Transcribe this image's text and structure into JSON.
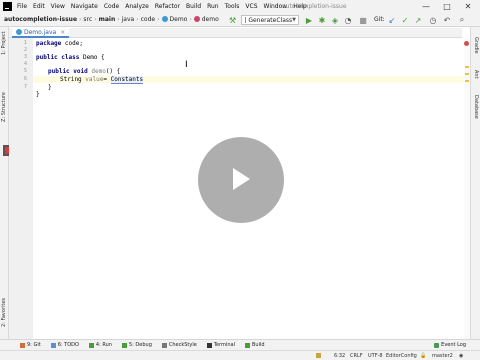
{
  "menubar": {
    "items": [
      "File",
      "Edit",
      "View",
      "Navigate",
      "Code",
      "Analyze",
      "Refactor",
      "Build",
      "Run",
      "Tools",
      "VCS",
      "Window",
      "Help"
    ],
    "window_title": "autocompletion-issue",
    "controls": [
      "—",
      "□",
      "✕"
    ]
  },
  "navbar": {
    "crumbs": [
      "autocompletion-issue",
      "src",
      "main",
      "java",
      "code",
      "Demo",
      "demo"
    ],
    "run_config": "GenerateClass",
    "git_label": "Git:"
  },
  "tabs": [
    {
      "label": "Demo.java",
      "close": "×"
    }
  ],
  "left_strip": {
    "project": "1: Project",
    "structure": "Z: Structure",
    "favorites": "2: Favorites"
  },
  "right_strip": {
    "gradle": "Gradle",
    "ant": "Ant",
    "database": "Database"
  },
  "editor": {
    "line_numbers": [
      "1",
      "2",
      "3",
      "4",
      "5",
      "6",
      "7"
    ],
    "package_kw": "package",
    "package_name": " code;",
    "public_kw": "public",
    "class_kw": " class",
    "class_name": " Demo {",
    "public_kw2": "public",
    "void_kw": " void",
    "method_name": " demo",
    "method_sig": "() {",
    "string_type": "String",
    "var_name": " value",
    "assign": "= ",
    "typed": "Constants",
    "close_inner": "}",
    "close_outer": "}"
  },
  "bottom_tools": {
    "items": [
      "9: Git",
      "6: TODO",
      "4: Run",
      "5: Debug",
      "CheckStyle",
      "Terminal",
      "Build"
    ],
    "event_log": "Event Log"
  },
  "statusbar": {
    "position": "6:32",
    "line_sep": "CRLF",
    "encoding": "UTF-8",
    "editorconfig": "EditorConfig",
    "branch": "master2"
  },
  "colors": {
    "accent": "#4a88c7",
    "run_green": "#4b9d3a",
    "stop_red": "#d93a3a",
    "keyword": "#000080"
  }
}
